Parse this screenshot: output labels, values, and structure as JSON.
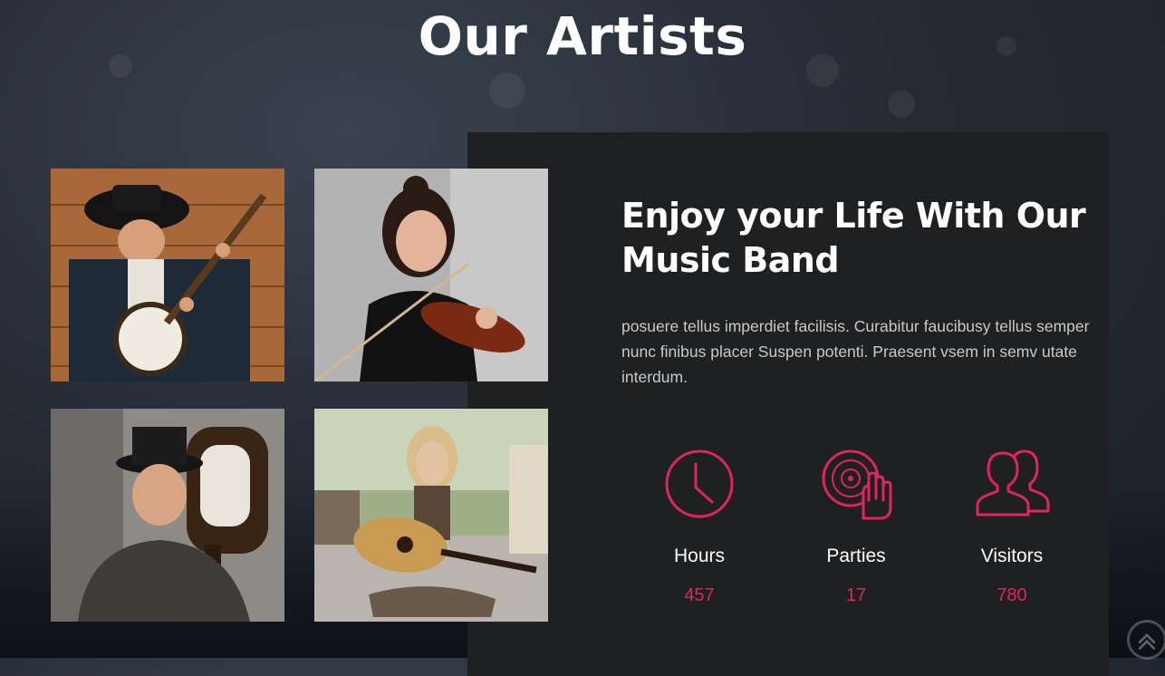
{
  "section": {
    "title": "Our Artists"
  },
  "artists": [
    {
      "name": "banjo-player-photo"
    },
    {
      "name": "violinist-photo"
    },
    {
      "name": "guitarist-photo"
    },
    {
      "name": "acoustic-guitarist-photo"
    }
  ],
  "promo": {
    "headline": "Enjoy your Life With Our Music Band",
    "body": "posuere tellus imperdiet facilisis. Curabitur faucibusy tellus semper nunc finibus placer Suspen potenti. Praesent vsem in semv utate interdum."
  },
  "stats": [
    {
      "label": "Hours",
      "value": "457",
      "icon": "clock-icon"
    },
    {
      "label": "Parties",
      "value": "17",
      "icon": "vinyl-hand-icon"
    },
    {
      "label": "Visitors",
      "value": "780",
      "icon": "users-icon"
    }
  ],
  "colors": {
    "accent": "#e0245e",
    "panel": "#1f2021",
    "text": "#ffffff"
  }
}
